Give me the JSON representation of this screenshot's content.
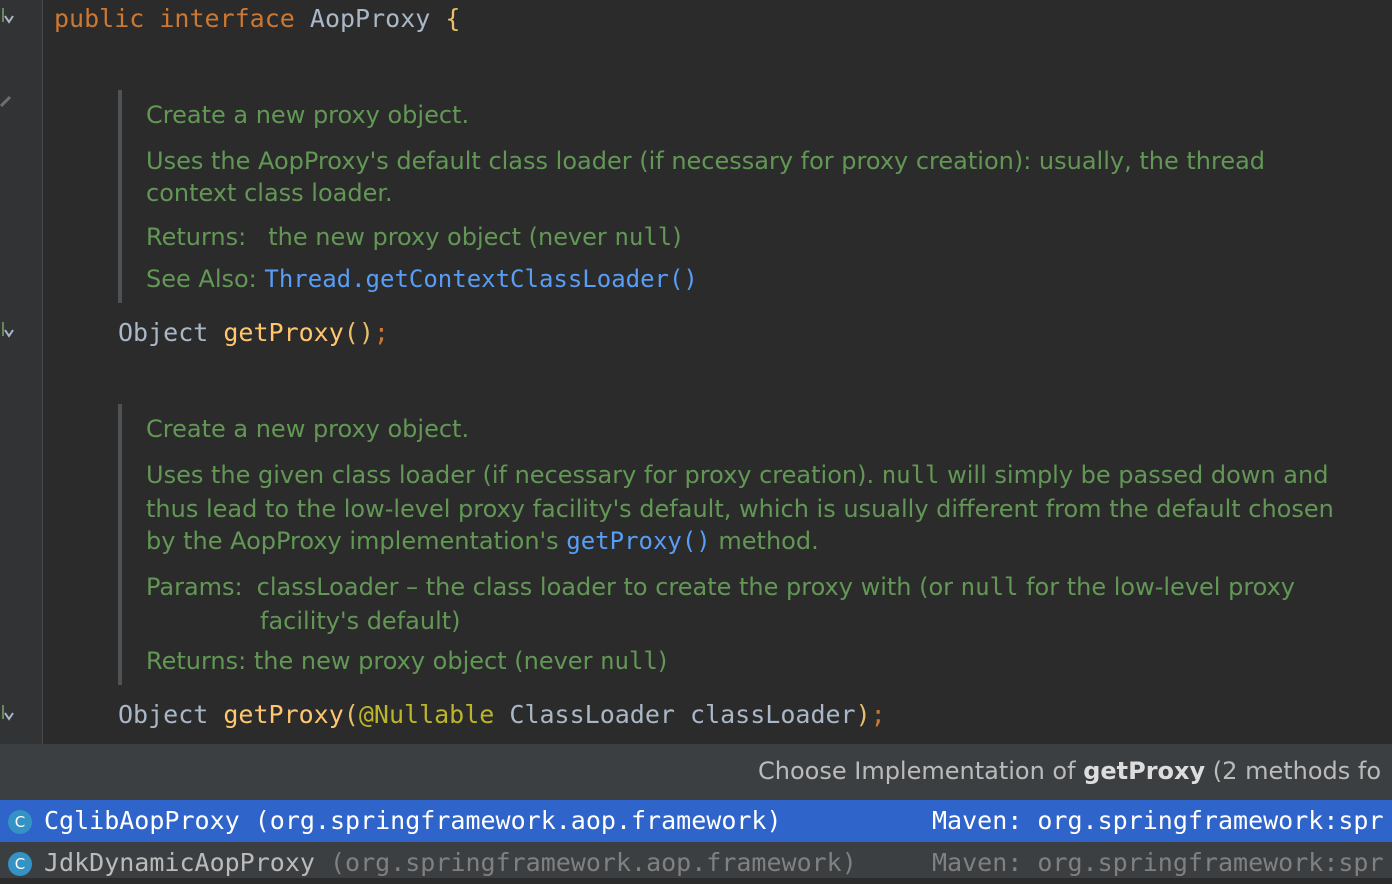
{
  "code": {
    "decl_kw1": "public",
    "decl_kw2": "interface",
    "decl_name": "AopProxy",
    "decl_brace": "{",
    "m1_type": "Object",
    "m1_name": "getProxy",
    "m1_parens": "()",
    "m1_semi": ";",
    "m2_type": "Object",
    "m2_name": "getProxy",
    "m2_open": "(",
    "m2_annotation": "@Nullable",
    "m2_param_type": "ClassLoader",
    "m2_param_name": "classLoader",
    "m2_close": ")",
    "m2_semi": ";"
  },
  "doc1": {
    "summary": "Create a new proxy object.",
    "body_line1": "Uses the AopProxy's default class loader (if necessary for proxy creation): usually, the thread",
    "body_line2": "context class loader.",
    "returns_label": "Returns:",
    "returns_text": "the new proxy object (never ",
    "returns_null": "null",
    "returns_end": ")",
    "see_label": "See Also:",
    "see_link": "Thread.getContextClassLoader()"
  },
  "doc2": {
    "summary": "Create a new proxy object.",
    "l1_a": "Uses the given class loader (if necessary for proxy creation). ",
    "l1_null": "null",
    "l1_b": " will simply be passed down and",
    "l2": "thus lead to the low-level proxy facility's default, which is usually different from the default chosen",
    "l3_a": "by the AopProxy implementation's ",
    "l3_link": "getProxy()",
    "l3_b": " method.",
    "params_label": "Params:",
    "params_a": "classLoader – the class loader to create the proxy with (or ",
    "params_null": "null",
    "params_b": " for the low-level proxy",
    "params_l2": "facility's default)",
    "returns_label": "Returns:",
    "returns_text": "the new proxy object (never ",
    "returns_null": "null",
    "returns_end": ")"
  },
  "popup": {
    "title_prefix": "Choose Implementation of ",
    "title_method": "getProxy",
    "title_suffix": " (2 methods fo",
    "items": [
      {
        "icon": "C",
        "class": "CglibAopProxy",
        "package": " (org.springframework.aop.framework)",
        "maven": "Maven: org.springframework:spr",
        "selected": true
      },
      {
        "icon": "C",
        "class": "JdkDynamicAopProxy",
        "package": " (org.springframework.aop.framework)",
        "maven": "Maven: org.springframework:spr",
        "selected": false
      }
    ]
  },
  "colors": {
    "editor_bg": "#2b2b2b",
    "keyword": "#cc7832",
    "method": "#ffc66d",
    "doc_text": "#629755",
    "link": "#589df6",
    "selection": "#2f65ca"
  },
  "icons": [
    "implemented-down-arrow-icon",
    "edit-pencil-icon",
    "class-icon"
  ]
}
